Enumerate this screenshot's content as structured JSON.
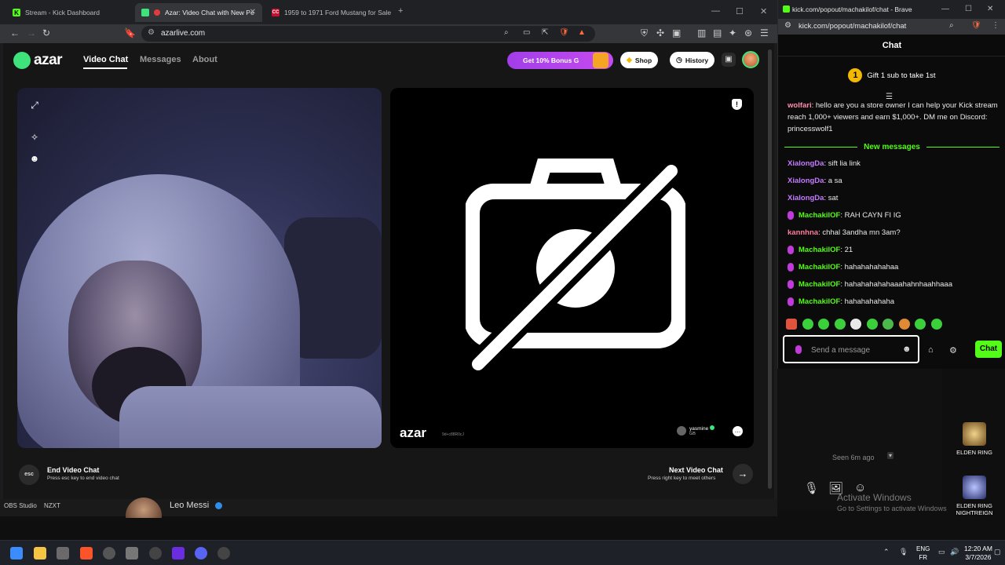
{
  "browser": {
    "tabs": [
      {
        "title": "Stream - Kick Dashboard"
      },
      {
        "title": "Azar: Video Chat with New Pe"
      },
      {
        "title": "1959 to 1971 Ford Mustang for Sale"
      }
    ],
    "url": "azarlive.com",
    "shield_badge": "7",
    "alert_badge": "1"
  },
  "azar": {
    "logo": "azar",
    "nav": {
      "video_chat": "Video Chat",
      "messages": "Messages",
      "about": "About"
    },
    "bonus_label": "Get 10% Bonus G",
    "shop_label": "Shop",
    "history_label": "History",
    "watermark": "azar",
    "watermark_id": "9d+c88R0cJ",
    "partner": {
      "name": "yasmine",
      "country": "GB"
    },
    "end": {
      "key": "esc",
      "title": "End Video Chat",
      "hint": "Press esc key to end video chat"
    },
    "next": {
      "title": "Next Video Chat",
      "hint": "Press right key to meet others"
    }
  },
  "popup": {
    "window_title": "kick.com/popout/machakilof/chat - Brave",
    "url": "kick.com/popout/machakilof/chat",
    "chat_title": "Chat",
    "gift_rank": "1",
    "gift_text": "Gift 1 sub to take 1st",
    "pinned": {
      "user": "wolfari",
      "text": ": hello are you a store owner I can help your Kick stream reach 1,000+ viewers and earn $1,000+. DM me on Discord: princesswolf1"
    },
    "new_messages_label": "New messages",
    "messages": [
      {
        "user": "XialongDa",
        "text": ": sift lia link",
        "mic": false,
        "color": "#c57bff"
      },
      {
        "user": "XialongDa",
        "text": ": a sa",
        "mic": false,
        "color": "#c57bff"
      },
      {
        "user": "XialongDa",
        "text": ": sat",
        "mic": false,
        "color": "#c57bff"
      },
      {
        "user": "MachakilOF",
        "text": ": RAH CAYN FI IG",
        "mic": true,
        "color": "#53fc18"
      },
      {
        "user": "kannhna",
        "text": ": chhal 3andha mn 3am?",
        "mic": false,
        "color": "#ff7a9e"
      },
      {
        "user": "MachakilOF",
        "text": ": 21",
        "mic": true,
        "color": "#53fc18"
      },
      {
        "user": "MachakilOF",
        "text": ": hahahahahahaa",
        "mic": true,
        "color": "#53fc18"
      },
      {
        "user": "MachakilOF",
        "text": ": hahahahahahaaahahnhaahhaaa",
        "mic": true,
        "color": "#53fc18"
      },
      {
        "user": "MachakilOF",
        "text": ": hahahahahaha",
        "mic": true,
        "color": "#53fc18"
      }
    ],
    "input_placeholder": "Send a message",
    "chat_button": "Chat"
  },
  "background": {
    "seen": "Seen 6m ago",
    "activate_title": "Activate Windows",
    "activate_sub": "Go to Settings to activate Windows"
  },
  "desktop": {
    "icons": [
      {
        "label": "ELDEN RING"
      },
      {
        "label": "ELDEN RING NIGHTREIGN"
      }
    ]
  },
  "strip": {
    "obs": "OBS Studio",
    "nzxt": "NZXT",
    "leo": "Leo Messi"
  },
  "taskbar": {
    "lang": "ENG",
    "lang2": "FR",
    "time": "12:20 AM",
    "date": "3/7/2026"
  }
}
